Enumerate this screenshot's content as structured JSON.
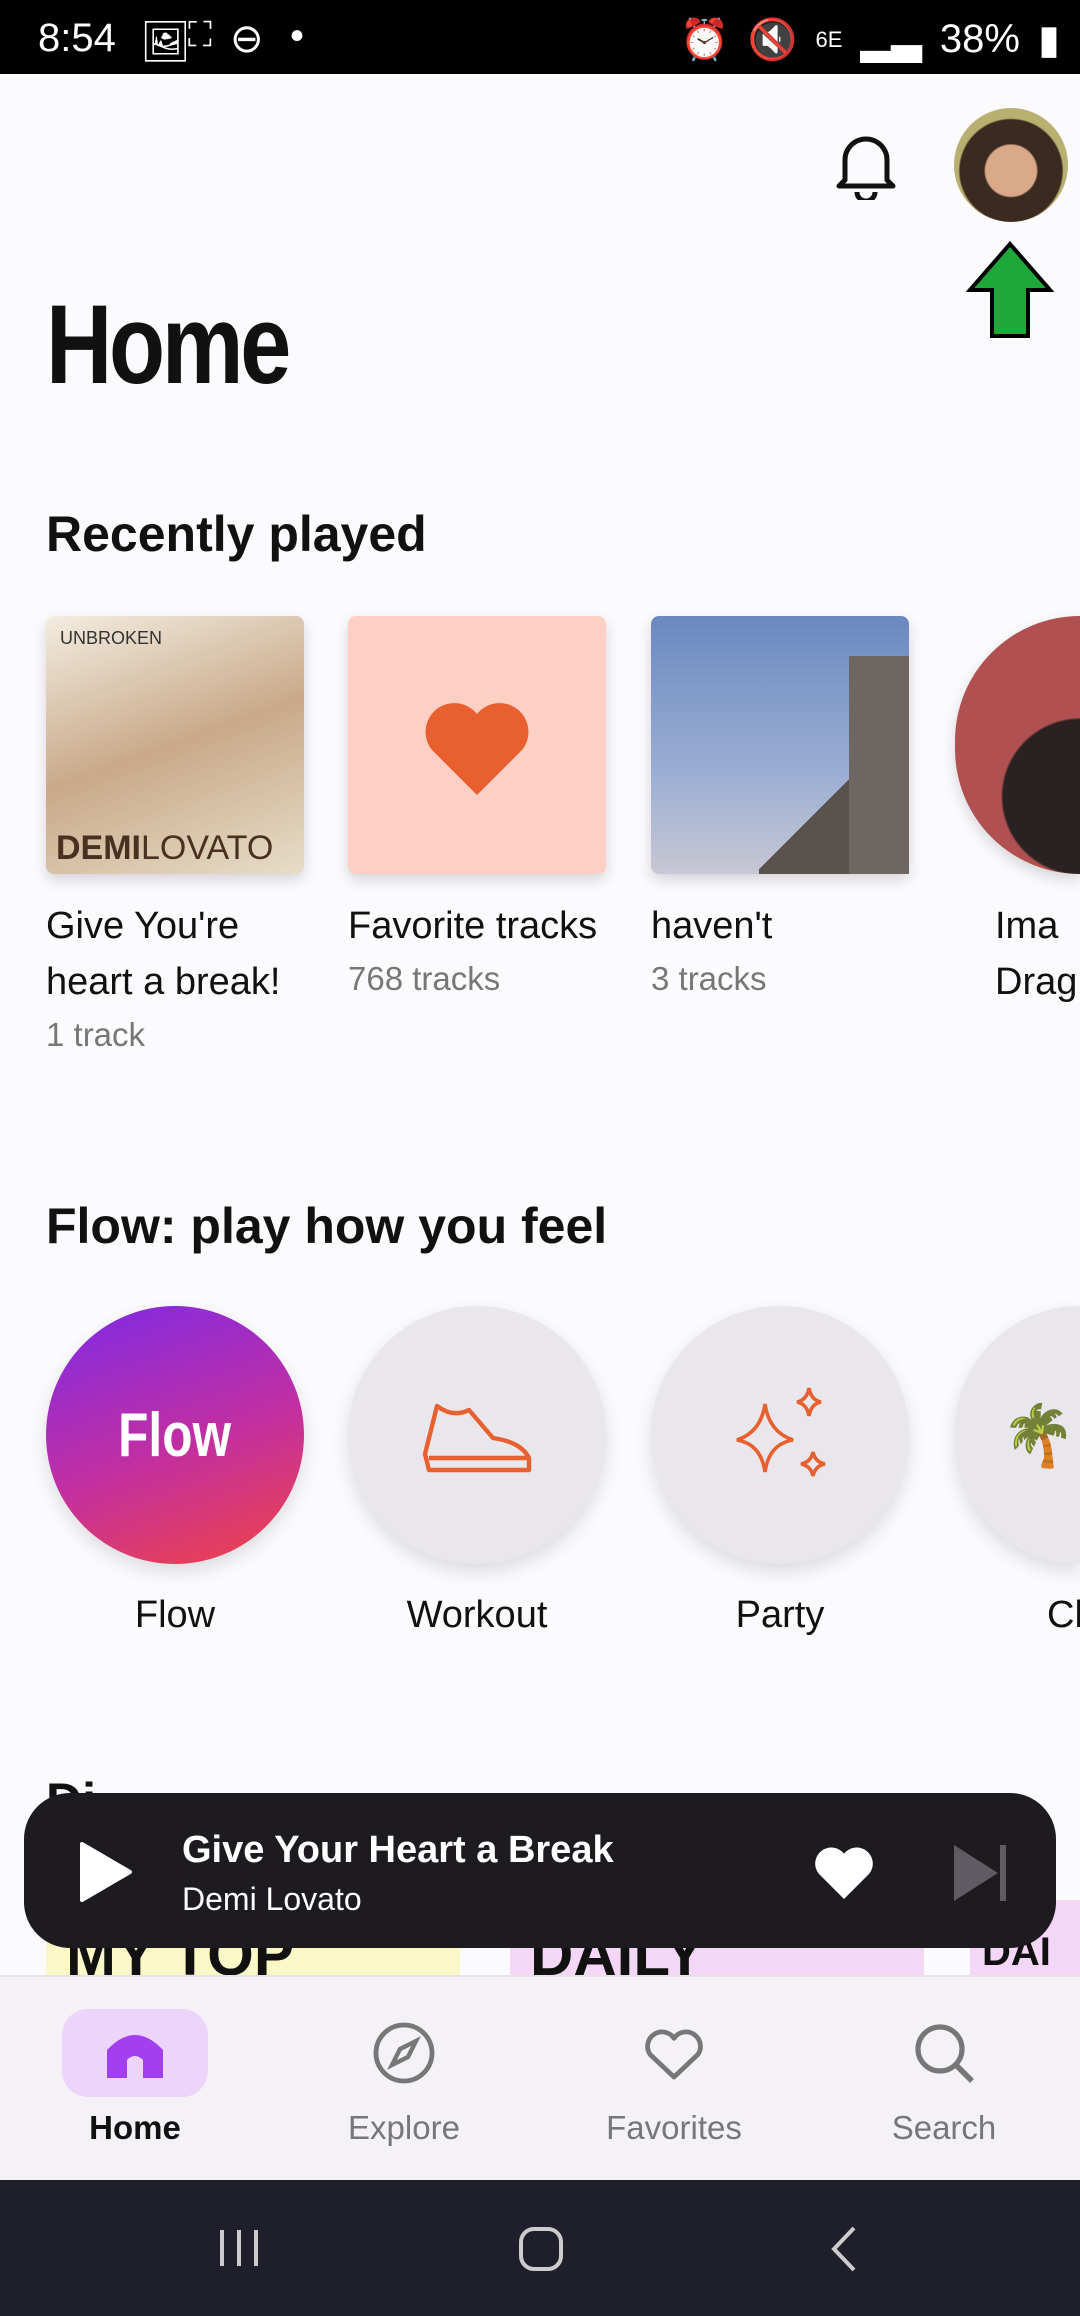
{
  "status": {
    "time": "8:54",
    "battery": "38%",
    "network": "6E"
  },
  "header": {
    "title": "Home",
    "avatar_name": "avatar"
  },
  "recent": {
    "title": "Recently played",
    "items": [
      {
        "title_line1": "Give You're",
        "title_line2": "heart a break!",
        "subtitle": "1 track",
        "art_top": "UNBROKEN",
        "art_bottom_bold": "DEMI",
        "art_bottom": "LOVATO"
      },
      {
        "title_line1": "Favorite tracks",
        "subtitle": "768 tracks"
      },
      {
        "title_line1": "haven't",
        "subtitle": "3 tracks"
      },
      {
        "title_line1": "Ima",
        "title_line2": "Drag"
      }
    ]
  },
  "flow": {
    "title": "Flow: play how you feel",
    "items": [
      {
        "label": "Flow",
        "logo": "Flow"
      },
      {
        "label": "Workout"
      },
      {
        "label": "Party"
      },
      {
        "label": "Ch"
      }
    ]
  },
  "next_section": {
    "title": "Di"
  },
  "player": {
    "title": "Give Your Heart a Break",
    "artist": "Demi Lovato"
  },
  "peek": [
    "MY TOP SUMMER",
    "DAILY",
    "DAI"
  ],
  "nav": [
    {
      "label": "Home",
      "active": true
    },
    {
      "label": "Explore"
    },
    {
      "label": "Favorites"
    },
    {
      "label": "Search"
    }
  ],
  "colors": {
    "accent": "#a23ff0",
    "active_bg": "#ecd4fb",
    "orange": "#e8602f",
    "favorite_bg": "#fdd0c3"
  }
}
